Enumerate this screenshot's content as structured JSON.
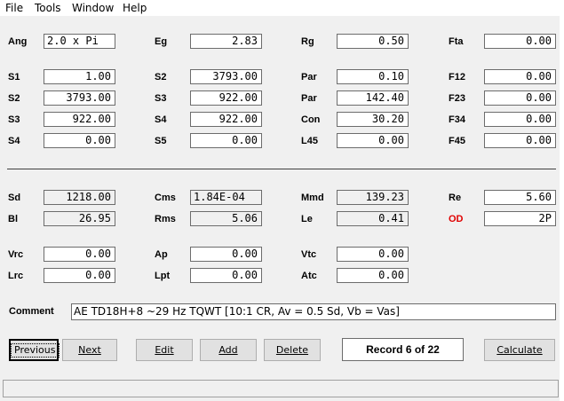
{
  "menu": [
    "File",
    "Tools",
    "Window",
    "Help"
  ],
  "colors": {
    "od_label": "#e00000"
  },
  "fields": [
    {
      "label": "Ang",
      "value": "2.0 x Pi",
      "align": "left"
    },
    {
      "label": "Eg",
      "value": "2.83"
    },
    {
      "label": "Rg",
      "value": "0.50"
    },
    {
      "label": "Fta",
      "value": "0.00"
    },
    {
      "label": "S1",
      "value": "1.00"
    },
    {
      "label": "S2",
      "value": "3793.00"
    },
    {
      "label": "Par",
      "value": "0.10"
    },
    {
      "label": "F12",
      "value": "0.00"
    },
    {
      "label": "S2",
      "value": "3793.00"
    },
    {
      "label": "S3",
      "value": "922.00"
    },
    {
      "label": "Par",
      "value": "142.40"
    },
    {
      "label": "F23",
      "value": "0.00"
    },
    {
      "label": "S3",
      "value": "922.00"
    },
    {
      "label": "S4",
      "value": "922.00"
    },
    {
      "label": "Con",
      "value": "30.20"
    },
    {
      "label": "F34",
      "value": "0.00"
    },
    {
      "label": "S4",
      "value": "0.00"
    },
    {
      "label": "S5",
      "value": "0.00"
    },
    {
      "label": "L45",
      "value": "0.00"
    },
    {
      "label": "F45",
      "value": "0.00"
    },
    {
      "label": "Sd",
      "value": "1218.00",
      "readonly": true
    },
    {
      "label": "Cms",
      "value": "1.84E-04",
      "readonly": true,
      "align": "left"
    },
    {
      "label": "Mmd",
      "value": "139.23",
      "readonly": true
    },
    {
      "label": "Re",
      "value": "5.60"
    },
    {
      "label": "Bl",
      "value": "26.95",
      "readonly": true
    },
    {
      "label": "Rms",
      "value": "5.06",
      "readonly": true
    },
    {
      "label": "Le",
      "value": "0.41",
      "readonly": true
    },
    {
      "label": "OD",
      "value": "2P",
      "highlight": true
    },
    {
      "label": "Vrc",
      "value": "0.00"
    },
    {
      "label": "Ap",
      "value": "0.00"
    },
    {
      "label": "Vtc",
      "value": "0.00"
    },
    {
      "label": "Lrc",
      "value": "0.00"
    },
    {
      "label": "Lpt",
      "value": "0.00"
    },
    {
      "label": "Atc",
      "value": "0.00"
    }
  ],
  "comment": {
    "label": "Comment",
    "value": "AE TD18H+8 ~29 Hz TQWT [10:1 CR, Av = 0.5 Sd, Vb = Vas]"
  },
  "buttons": {
    "previous": "Previous",
    "next": "Next",
    "edit": "Edit",
    "add": "Add",
    "delete": "Delete",
    "calculate": "Calculate"
  },
  "record": "Record 6 of 22"
}
